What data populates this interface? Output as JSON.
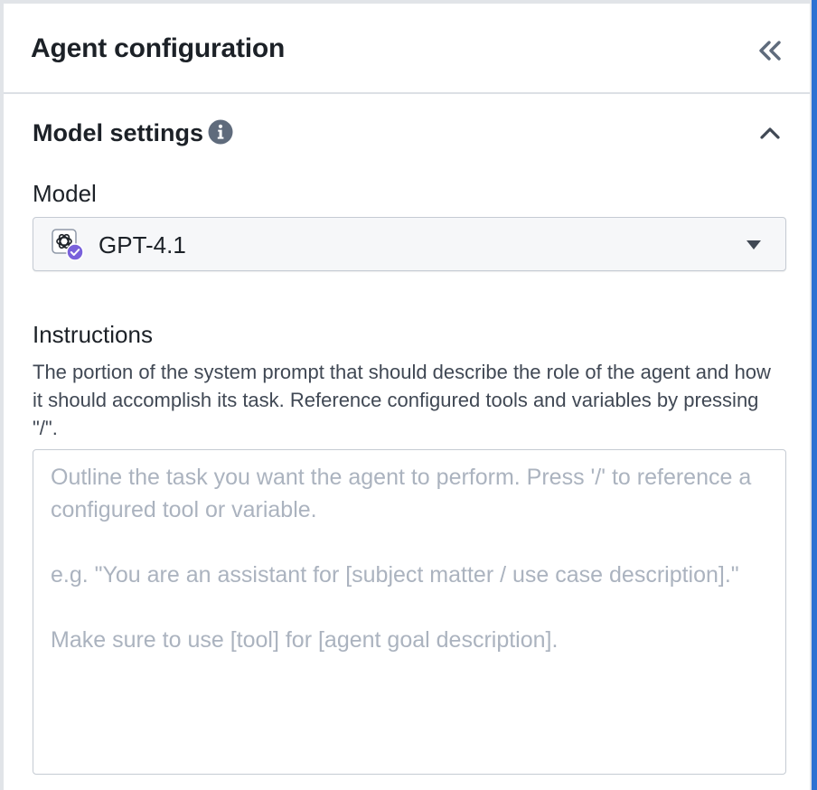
{
  "panel": {
    "title": "Agent configuration"
  },
  "model_settings": {
    "title": "Model settings",
    "model_label": "Model",
    "model_value": "GPT-4.1"
  },
  "instructions": {
    "label": "Instructions",
    "description": "The portion of the system prompt that should describe the role of the agent and how it should accomplish its task. Reference configured tools and variables by pressing \"/\".",
    "placeholder_lines": [
      "Outline the task you want the agent to perform. Press '/' to reference a configured tool or variable.",
      "e.g. \"You are an assistant for [subject matter / use case description].\"",
      "Make sure to use [tool] for [agent goal description]."
    ]
  },
  "icons": {
    "collapse": "double-chevron-left-icon",
    "info": "info-icon",
    "section_toggle": "chevron-up-icon",
    "model": "openai-logo-icon",
    "dropdown": "caret-down-icon"
  },
  "colors": {
    "accent": "#2d72d2",
    "verified_badge": "#7961db",
    "text": "#1c2127",
    "muted_text": "#404854",
    "placeholder": "#abb3bf"
  }
}
